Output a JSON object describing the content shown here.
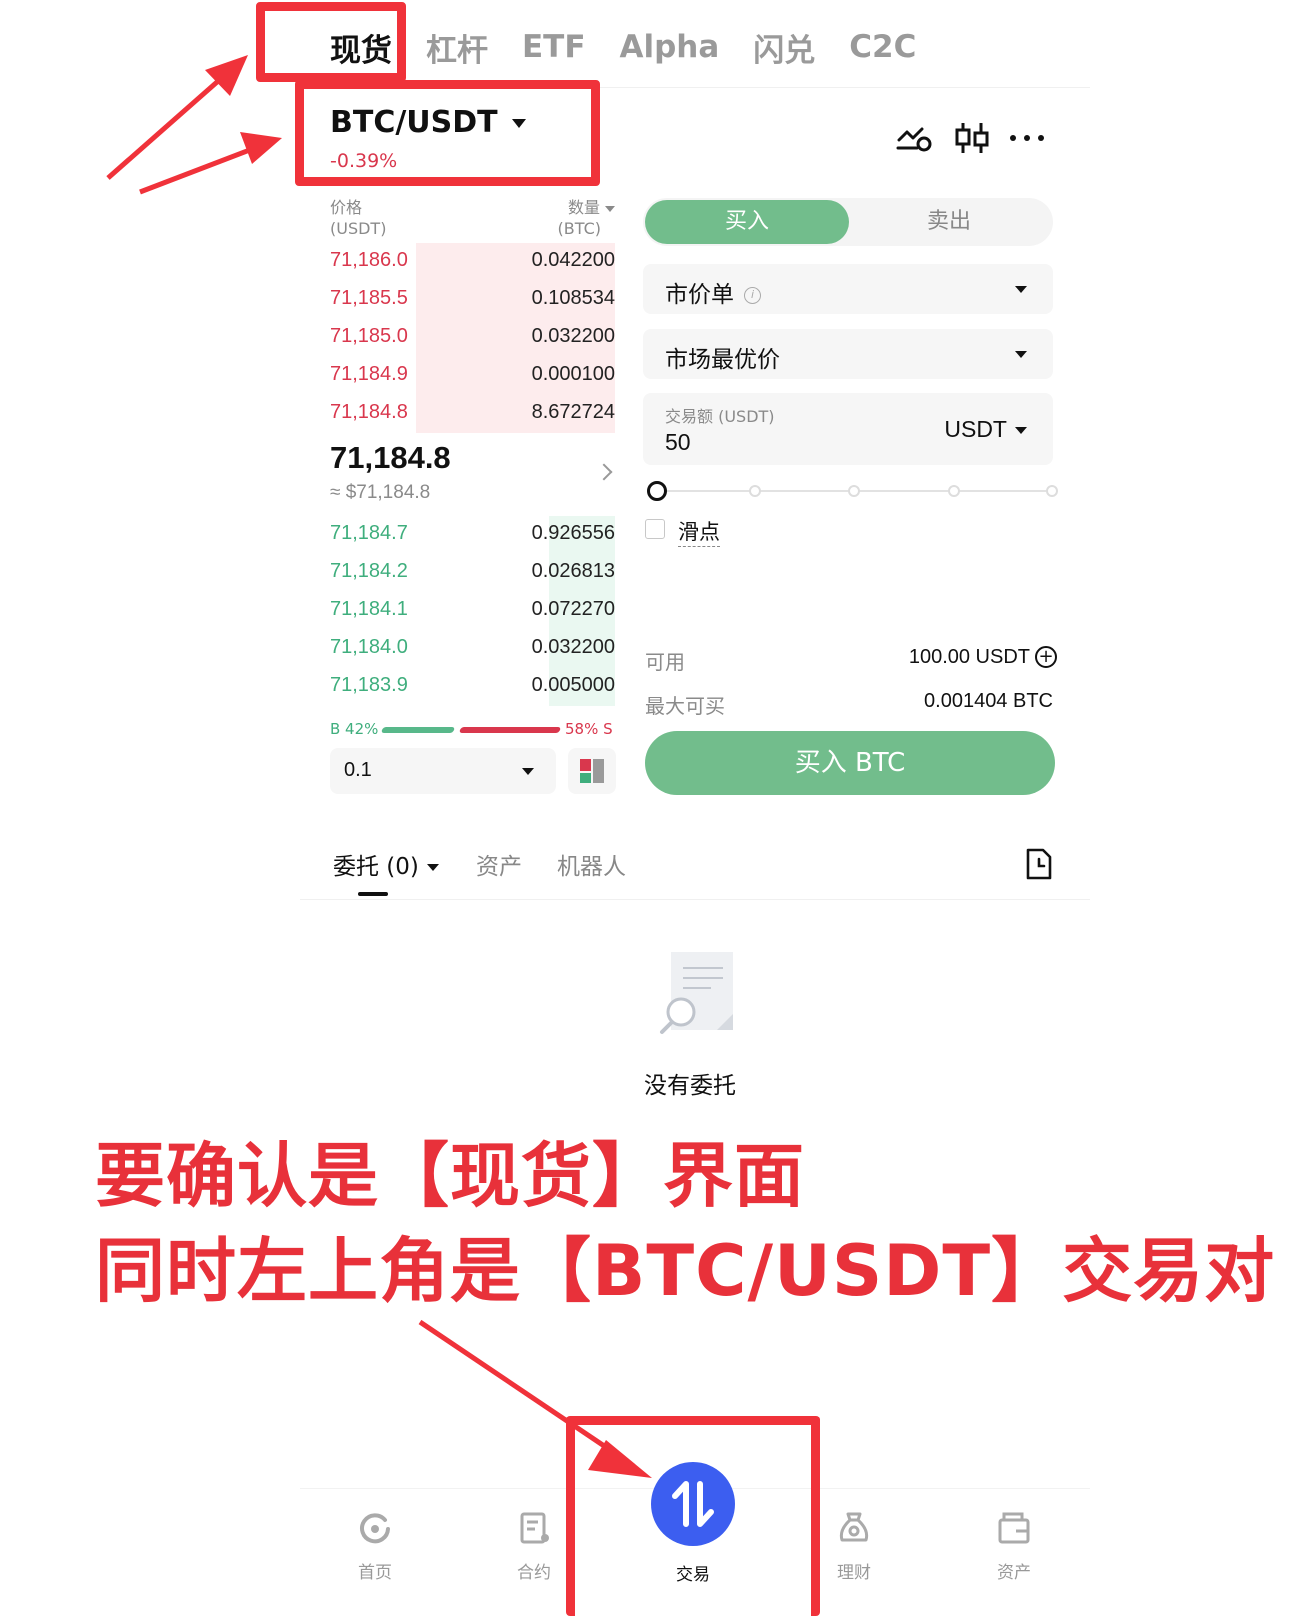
{
  "top_tabs": [
    "现货",
    "杠杆",
    "ETF",
    "Alpha",
    "闪兑",
    "C2C"
  ],
  "pair": {
    "symbol": "BTC/USDT",
    "change": "-0.39%"
  },
  "header_icons": [
    "price-alert-icon",
    "candlestick-chart-icon",
    "more-icon"
  ],
  "orderbook": {
    "price_header": "价格",
    "price_unit": "(USDT)",
    "qty_header": "数量",
    "qty_unit": "(BTC)",
    "asks": [
      {
        "price": "71,186.0",
        "qty": "0.042200",
        "depth": 0.7
      },
      {
        "price": "71,185.5",
        "qty": "0.108534",
        "depth": 0.7
      },
      {
        "price": "71,185.0",
        "qty": "0.032200",
        "depth": 0.7
      },
      {
        "price": "71,184.9",
        "qty": "0.000100",
        "depth": 0.7
      },
      {
        "price": "71,184.8",
        "qty": "8.672724",
        "depth": 0.7
      }
    ],
    "last_price": "71,184.8",
    "last_price_usd": "≈ $71,184.8",
    "bids": [
      {
        "price": "71,184.7",
        "qty": "0.926556",
        "depth": 0.23
      },
      {
        "price": "71,184.2",
        "qty": "0.026813",
        "depth": 0.23
      },
      {
        "price": "71,184.1",
        "qty": "0.072270",
        "depth": 0.23
      },
      {
        "price": "71,184.0",
        "qty": "0.032200",
        "depth": 0.23
      },
      {
        "price": "71,183.9",
        "qty": "0.005000",
        "depth": 0.23
      }
    ],
    "buy_ratio": "B 42%",
    "sell_ratio": "58% S",
    "precision": "0.1"
  },
  "trade": {
    "buy_tab": "买入",
    "sell_tab": "卖出",
    "order_type": "市价单",
    "price_mode": "市场最优价",
    "amount_label": "交易额 (USDT)",
    "amount_value": "50",
    "amount_unit": "USDT",
    "slider_percent": 0,
    "slippage_label": "滑点",
    "available_label": "可用",
    "available_value": "100.00 USDT",
    "max_buy_label": "最大可买",
    "max_buy_value": "0.001404 BTC",
    "submit_label": "买入 BTC"
  },
  "orders": {
    "tabs": [
      "委托 (0)",
      "资产",
      "机器人"
    ],
    "empty_text": "没有委托"
  },
  "annotation": {
    "line1": "要确认是【现货】界面",
    "line2": "同时左上角是【BTC/USDT】交易对"
  },
  "bottom_nav": [
    "首页",
    "合约",
    "交易",
    "理财",
    "资产"
  ],
  "colors": {
    "sell_red": "#d9374d",
    "buy_green": "#3fae7d",
    "buy_button": "#72bd8c",
    "highlight_red": "#f0323a",
    "nav_accent": "#3c5ef0"
  }
}
